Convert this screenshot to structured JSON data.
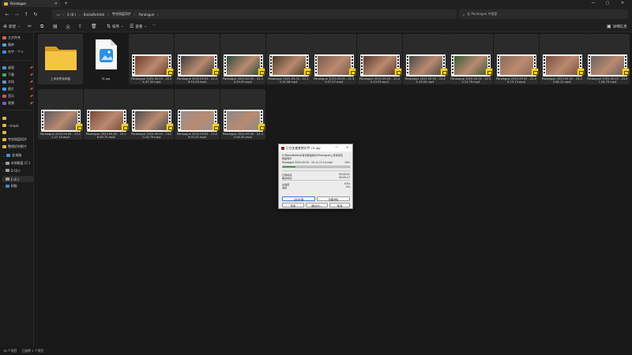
{
  "window": {
    "tab_title": "Paralogue",
    "new_tab": "+",
    "controls": {
      "min": "—",
      "max": "▢",
      "close": "✕"
    }
  },
  "nav": {
    "back": "←",
    "forward": "→",
    "up": "↑",
    "refresh": "↻"
  },
  "address": {
    "crumbs": [
      "E (E:)",
      "BaiduNetdisk",
      "夸克网盘同步",
      "Paralogue"
    ]
  },
  "search": {
    "placeholder": "在 Paralogue 中搜索"
  },
  "toolbar": {
    "new_label": "新建",
    "sort_label": "排序",
    "view_label": "查看",
    "more": "···",
    "details_label": "详细信息"
  },
  "sidebar": {
    "items": [
      {
        "label": "主文件夹",
        "color": "#d8643d"
      },
      {
        "label": "图库",
        "color": "#5aa0e8"
      },
      {
        "label": "杰宇 - 个人",
        "color": "#3b8ad8"
      },
      {
        "label": "桌面",
        "color": "#4a90d9"
      },
      {
        "label": "下载",
        "color": "#3bb06a"
      },
      {
        "label": "文档",
        "color": "#6b8ed0"
      },
      {
        "label": "图片",
        "color": "#3aa0dd"
      },
      {
        "label": "音乐",
        "color": "#d4506a"
      },
      {
        "label": "视频",
        "color": "#8a55c8"
      },
      {
        "label": "",
        "color": "#e2b33c"
      },
      {
        "label": "--mask",
        "color": "#e2b33c"
      },
      {
        "label": "",
        "color": "#e2b33c"
      },
      {
        "label": "夸克网盘同步",
        "color": "#e2b33c"
      },
      {
        "label": "整理好的影片",
        "color": "#e2b33c"
      }
    ],
    "drives": [
      {
        "label": "此电脑",
        "color": "#4a90d9"
      },
      {
        "label": "本地磁盘 (C:)",
        "color": "#9aa0a8"
      },
      {
        "label": "D (D:)",
        "color": "#9aa0a8"
      },
      {
        "label": "E (E:)",
        "color": "#9aa0a8"
      },
      {
        "label": "网络",
        "color": "#3b8ad8"
      }
    ]
  },
  "files": [
    {
      "name": "上传到夸克网盘",
      "kind": "folder"
    },
    {
      "name": "f4.jpg",
      "kind": "jpg"
    },
    {
      "name": "Paralogue 2025.09.05 - 22.24.47.02.mp4",
      "kind": "video",
      "thumb": "#6a3a2a"
    },
    {
      "name": "Paralogue 2025.09.05 - 22.26.15.03.mp4",
      "kind": "video",
      "thumb": "#3a3a3a"
    },
    {
      "name": "Paralogue 2025.09.05 - 22.30.09.09.mp4",
      "kind": "video",
      "thumb": "#2f4a3a"
    },
    {
      "name": "Paralogue 2025.09.05 - 22.33.10.08.mp4",
      "kind": "video",
      "thumb": "#4a3a2a"
    },
    {
      "name": "Paralogue 2025.09.05 - 22.39.27.07.mp4",
      "kind": "video",
      "thumb": "#7a5a4a"
    },
    {
      "name": "Paralogue 2025.09.05 - 22.40.13.03.mp4",
      "kind": "video",
      "thumb": "#5a3a30"
    },
    {
      "name": "Paralogue 2025.09.05 - 22.45.16.09.mp4",
      "kind": "video",
      "thumb": "#4a4a4a"
    },
    {
      "name": "Paralogue 2025.09.05 - 22.53.13.79.mp4",
      "kind": "video",
      "thumb": "#3a5a3a"
    },
    {
      "name": "Paralogue 2025.09.05 - 22.59.15.13.mp4",
      "kind": "video",
      "thumb": "#8a6a5a"
    },
    {
      "name": "Paralogue 2025.09.05 - 23.03.58.12.mp4",
      "kind": "video",
      "thumb": "#7a5040"
    },
    {
      "name": "Paralogue 2025.09.05 - 23.07.26.73.mp4",
      "kind": "video",
      "thumb": "#6a6060"
    },
    {
      "name": "Paralogue 2025.09.05 - 23.11.27.14.mp4",
      "kind": "video",
      "thumb": "#5a5560"
    },
    {
      "name": "Paralogue 2025.09.05 - 23.16.09.75.mp4",
      "kind": "video",
      "thumb": "#7a4a3a"
    },
    {
      "name": "Paralogue 2025.09.05 - 23.20.10.79.mp4",
      "kind": "video",
      "thumb": "#4a4a50"
    },
    {
      "name": "Paralogue 2025.09.05 - 23.29.01.37.mp4",
      "kind": "video",
      "thumb": "#9a9090"
    },
    {
      "name": "Paralogue 2025.09.05 - 23.32.04.35.mp4",
      "kind": "video",
      "thumb": "#8a8a8a"
    }
  ],
  "status": {
    "count": "18 个项目",
    "selected": "已选择 1 个项目"
  },
  "dialog": {
    "title": "正在加速复制文件 15.jpg",
    "path_line1": "E:\\BaiduNetdisk\\夸克网盘同步\\Paralogue\\上传到夸克",
    "path_line2": "网盘同步",
    "current_file": "Paralogue 2025.09.05 - 23.11.27.14.mp4",
    "file_percent": "19%",
    "progress": 0.19,
    "elapsed_label": "已用时间",
    "elapsed_value": "00:00:01",
    "remaining_label": "剩余时间",
    "remaining_value": "00:00:17",
    "total_label": "总进度",
    "total_value": "67%",
    "speed_label": "速度",
    "speed_value": "0%",
    "btn_background": "后台处理",
    "btn_details": "隐藏详情",
    "btn_pause": "暂停",
    "btn_skip": "跳过(K)...",
    "btn_cancel": "取消"
  }
}
